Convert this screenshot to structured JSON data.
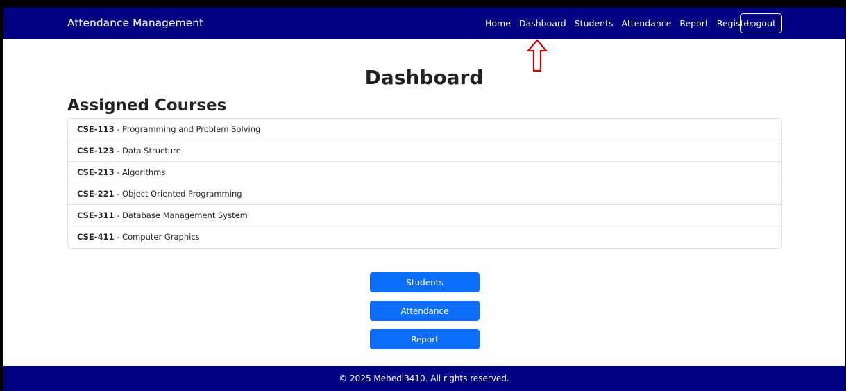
{
  "navbar": {
    "brand": "Attendance Management",
    "links": [
      "Home",
      "Dashboard",
      "Students",
      "Attendance",
      "Report",
      "Register"
    ],
    "logout_label": "Logout",
    "background_color": "#000080"
  },
  "annotation": {
    "icon": "up-arrow-icon",
    "color": "#d00000"
  },
  "main": {
    "title": "Dashboard",
    "section_title": "Assigned Courses",
    "courses": [
      {
        "code": "CSE-113",
        "name": " - Programming and Problem Solving"
      },
      {
        "code": "CSE-123",
        "name": " - Data Structure"
      },
      {
        "code": "CSE-213",
        "name": " - Algorithms"
      },
      {
        "code": "CSE-221",
        "name": " - Object Oriented Programming"
      },
      {
        "code": "CSE-311",
        "name": " - Database Management System"
      },
      {
        "code": "CSE-411",
        "name": " - Computer Graphics"
      }
    ],
    "buttons": [
      "Students",
      "Attendance",
      "Report"
    ],
    "button_color": "#0d6efd"
  },
  "footer": {
    "text": "© 2025 Mehedi3410. All rights reserved."
  }
}
